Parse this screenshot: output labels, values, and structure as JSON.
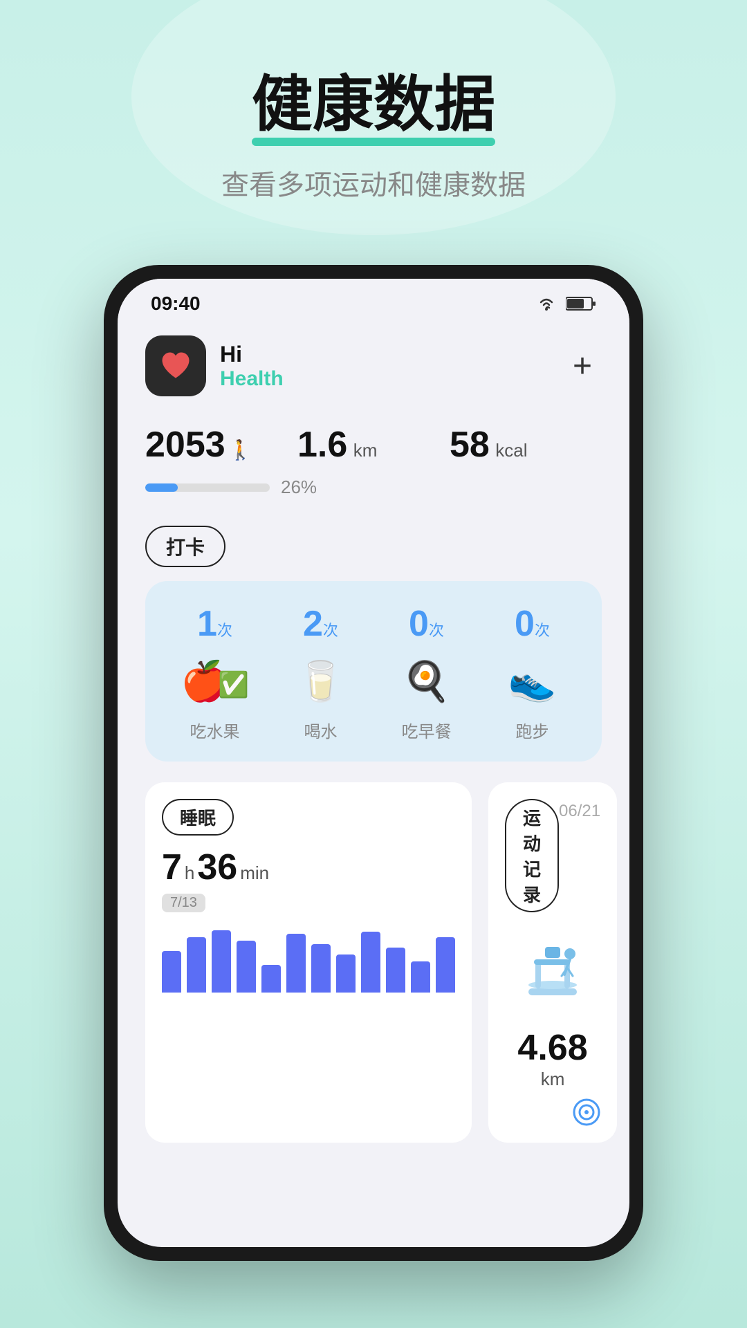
{
  "hero": {
    "title": "健康数据",
    "subtitle": "查看多项运动和健康数据"
  },
  "status_bar": {
    "time": "09:40"
  },
  "app_header": {
    "hi": "Hi",
    "health": "Health",
    "add_btn": "+"
  },
  "stats": {
    "steps": "2053",
    "steps_unit": "步",
    "distance": "1.6",
    "distance_unit": "km",
    "calories": "58",
    "calories_unit": "kcal",
    "progress_pct": "26%",
    "progress_value": 26
  },
  "punch": {
    "label": "打卡",
    "items": [
      {
        "count": "1",
        "unit": "次",
        "name": "吃水果",
        "icon": "fruit"
      },
      {
        "count": "2",
        "unit": "次",
        "name": "喝水",
        "icon": "water"
      },
      {
        "count": "0",
        "unit": "次",
        "name": "吃早餐",
        "icon": "breakfast"
      },
      {
        "count": "0",
        "unit": "次",
        "name": "跑步",
        "icon": "run"
      }
    ]
  },
  "sleep": {
    "label": "睡眠",
    "hours": "7",
    "hours_unit": "h",
    "minutes": "36",
    "minutes_unit": "min",
    "date_badge": "7/13",
    "bars": [
      60,
      80,
      90,
      75,
      40,
      85,
      70,
      55,
      88,
      65,
      45,
      80
    ]
  },
  "exercise": {
    "label": "运动记录",
    "date": "06/21",
    "distance": "4.68",
    "distance_unit": "km"
  }
}
